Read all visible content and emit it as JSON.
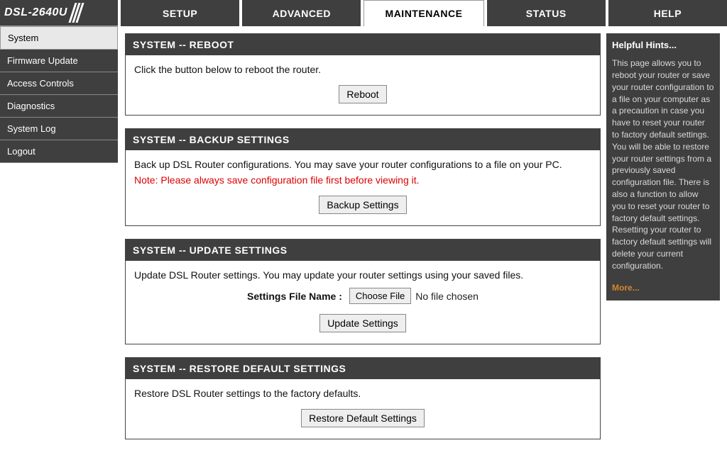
{
  "logo": {
    "model": "DSL-2640U"
  },
  "nav": {
    "tabs": [
      "SETUP",
      "ADVANCED",
      "MAINTENANCE",
      "STATUS",
      "HELP"
    ],
    "active_index": 2
  },
  "sidebar": {
    "items": [
      "System",
      "Firmware Update",
      "Access Controls",
      "Diagnostics",
      "System Log",
      "Logout"
    ],
    "active_index": 0
  },
  "panels": {
    "reboot": {
      "title": "SYSTEM -- REBOOT",
      "desc": "Click the button below to reboot the router.",
      "button": "Reboot"
    },
    "backup": {
      "title": "SYSTEM -- BACKUP SETTINGS",
      "desc": "Back up DSL Router configurations. You may save your router configurations to a file on your PC.",
      "note": "Note: Please always save configuration file first before viewing it.",
      "button": "Backup Settings"
    },
    "update": {
      "title": "SYSTEM -- UPDATE SETTINGS",
      "desc": "Update DSL Router settings. You may update your router settings using your saved files.",
      "file_label": "Settings File Name :",
      "choose_button": "Choose File",
      "no_file": "No file chosen",
      "button": "Update Settings"
    },
    "restore": {
      "title": "SYSTEM -- RESTORE DEFAULT SETTINGS",
      "desc": "Restore DSL Router settings to the factory defaults.",
      "button": "Restore Default Settings"
    }
  },
  "help": {
    "title": "Helpful Hints...",
    "body": "This page allows you to reboot your router or save your router configuration to a file on your computer as a precaution in case you have to reset your router to factory default settings. You will be able to restore your router settings from a previously saved configuration file. There is also a function to allow you to reset your router to factory default settings. Resetting your router to factory default settings will delete your current configuration.",
    "more": "More..."
  }
}
